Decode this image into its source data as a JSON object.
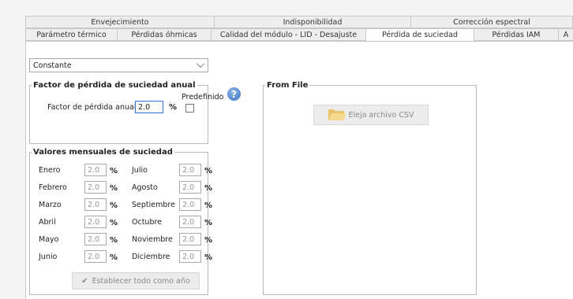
{
  "tabs_top": [
    {
      "label": "Envejecimiento"
    },
    {
      "label": "Indisponibilidad"
    },
    {
      "label": "Corrección espectral"
    }
  ],
  "tabs_bottom": [
    {
      "label": "Parámetro térmico"
    },
    {
      "label": "Pérdidas óhmicas"
    },
    {
      "label": "Calidad del módulo - LID - Desajuste"
    },
    {
      "label": "Pérdida de suciedad",
      "active": true
    },
    {
      "label": "Pérdidas IAM"
    },
    {
      "label": "A"
    }
  ],
  "mode_select": {
    "value": "Constante"
  },
  "annual_group": {
    "title": "Factor de pérdida de suciedad anual",
    "factor_label": "Factor de pérdida anual",
    "factor_value": "2.0",
    "unit": "%",
    "default_label": "Predefinido",
    "default_checked": false
  },
  "monthly_group": {
    "title": "Valores mensuales de suciedad",
    "unit": "%",
    "months": [
      {
        "name": "Enero",
        "value": "2.0"
      },
      {
        "name": "Febrero",
        "value": "2.0"
      },
      {
        "name": "Marzo",
        "value": "2.0"
      },
      {
        "name": "Abril",
        "value": "2.0"
      },
      {
        "name": "Mayo",
        "value": "2.0"
      },
      {
        "name": "Junio",
        "value": "2.0"
      },
      {
        "name": "Julio",
        "value": "2.0"
      },
      {
        "name": "Agosto",
        "value": "2.0"
      },
      {
        "name": "Septiembre",
        "value": "2.0"
      },
      {
        "name": "Octubre",
        "value": "2.0"
      },
      {
        "name": "Noviembre",
        "value": "2.0"
      },
      {
        "name": "Diciembre",
        "value": "2.0"
      }
    ],
    "set_all_button": "Establecer todo como año"
  },
  "file_group": {
    "title": "From File",
    "choose_button": "Eleja archivo CSV"
  },
  "colors": {
    "accent": "#2f6fd6",
    "help_icon": "#3a73c6",
    "folder": "#e8c36a"
  }
}
